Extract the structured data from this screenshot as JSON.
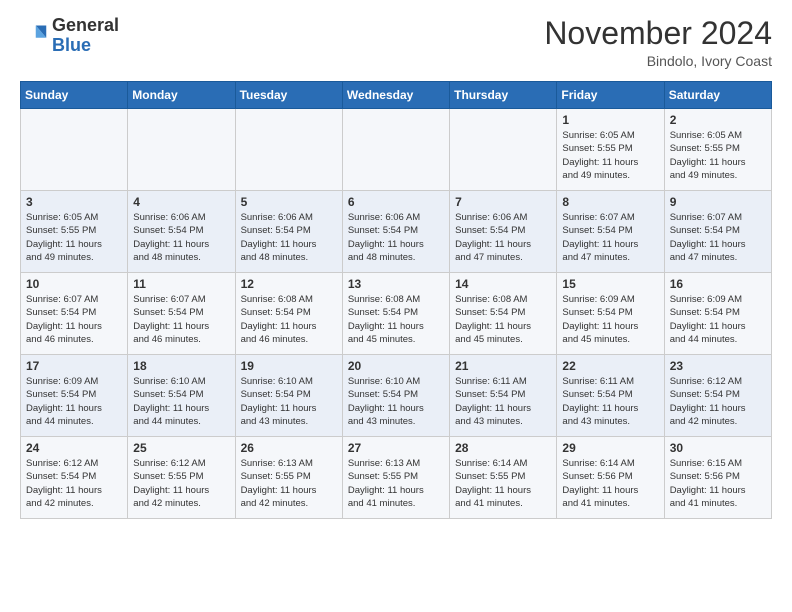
{
  "logo": {
    "general": "General",
    "blue": "Blue"
  },
  "header": {
    "month": "November 2024",
    "location": "Bindolo, Ivory Coast"
  },
  "weekdays": [
    "Sunday",
    "Monday",
    "Tuesday",
    "Wednesday",
    "Thursday",
    "Friday",
    "Saturday"
  ],
  "weeks": [
    [
      {
        "day": "",
        "info": ""
      },
      {
        "day": "",
        "info": ""
      },
      {
        "day": "",
        "info": ""
      },
      {
        "day": "",
        "info": ""
      },
      {
        "day": "",
        "info": ""
      },
      {
        "day": "1",
        "info": "Sunrise: 6:05 AM\nSunset: 5:55 PM\nDaylight: 11 hours\nand 49 minutes."
      },
      {
        "day": "2",
        "info": "Sunrise: 6:05 AM\nSunset: 5:55 PM\nDaylight: 11 hours\nand 49 minutes."
      }
    ],
    [
      {
        "day": "3",
        "info": "Sunrise: 6:05 AM\nSunset: 5:55 PM\nDaylight: 11 hours\nand 49 minutes."
      },
      {
        "day": "4",
        "info": "Sunrise: 6:06 AM\nSunset: 5:54 PM\nDaylight: 11 hours\nand 48 minutes."
      },
      {
        "day": "5",
        "info": "Sunrise: 6:06 AM\nSunset: 5:54 PM\nDaylight: 11 hours\nand 48 minutes."
      },
      {
        "day": "6",
        "info": "Sunrise: 6:06 AM\nSunset: 5:54 PM\nDaylight: 11 hours\nand 48 minutes."
      },
      {
        "day": "7",
        "info": "Sunrise: 6:06 AM\nSunset: 5:54 PM\nDaylight: 11 hours\nand 47 minutes."
      },
      {
        "day": "8",
        "info": "Sunrise: 6:07 AM\nSunset: 5:54 PM\nDaylight: 11 hours\nand 47 minutes."
      },
      {
        "day": "9",
        "info": "Sunrise: 6:07 AM\nSunset: 5:54 PM\nDaylight: 11 hours\nand 47 minutes."
      }
    ],
    [
      {
        "day": "10",
        "info": "Sunrise: 6:07 AM\nSunset: 5:54 PM\nDaylight: 11 hours\nand 46 minutes."
      },
      {
        "day": "11",
        "info": "Sunrise: 6:07 AM\nSunset: 5:54 PM\nDaylight: 11 hours\nand 46 minutes."
      },
      {
        "day": "12",
        "info": "Sunrise: 6:08 AM\nSunset: 5:54 PM\nDaylight: 11 hours\nand 46 minutes."
      },
      {
        "day": "13",
        "info": "Sunrise: 6:08 AM\nSunset: 5:54 PM\nDaylight: 11 hours\nand 45 minutes."
      },
      {
        "day": "14",
        "info": "Sunrise: 6:08 AM\nSunset: 5:54 PM\nDaylight: 11 hours\nand 45 minutes."
      },
      {
        "day": "15",
        "info": "Sunrise: 6:09 AM\nSunset: 5:54 PM\nDaylight: 11 hours\nand 45 minutes."
      },
      {
        "day": "16",
        "info": "Sunrise: 6:09 AM\nSunset: 5:54 PM\nDaylight: 11 hours\nand 44 minutes."
      }
    ],
    [
      {
        "day": "17",
        "info": "Sunrise: 6:09 AM\nSunset: 5:54 PM\nDaylight: 11 hours\nand 44 minutes."
      },
      {
        "day": "18",
        "info": "Sunrise: 6:10 AM\nSunset: 5:54 PM\nDaylight: 11 hours\nand 44 minutes."
      },
      {
        "day": "19",
        "info": "Sunrise: 6:10 AM\nSunset: 5:54 PM\nDaylight: 11 hours\nand 43 minutes."
      },
      {
        "day": "20",
        "info": "Sunrise: 6:10 AM\nSunset: 5:54 PM\nDaylight: 11 hours\nand 43 minutes."
      },
      {
        "day": "21",
        "info": "Sunrise: 6:11 AM\nSunset: 5:54 PM\nDaylight: 11 hours\nand 43 minutes."
      },
      {
        "day": "22",
        "info": "Sunrise: 6:11 AM\nSunset: 5:54 PM\nDaylight: 11 hours\nand 43 minutes."
      },
      {
        "day": "23",
        "info": "Sunrise: 6:12 AM\nSunset: 5:54 PM\nDaylight: 11 hours\nand 42 minutes."
      }
    ],
    [
      {
        "day": "24",
        "info": "Sunrise: 6:12 AM\nSunset: 5:54 PM\nDaylight: 11 hours\nand 42 minutes."
      },
      {
        "day": "25",
        "info": "Sunrise: 6:12 AM\nSunset: 5:55 PM\nDaylight: 11 hours\nand 42 minutes."
      },
      {
        "day": "26",
        "info": "Sunrise: 6:13 AM\nSunset: 5:55 PM\nDaylight: 11 hours\nand 42 minutes."
      },
      {
        "day": "27",
        "info": "Sunrise: 6:13 AM\nSunset: 5:55 PM\nDaylight: 11 hours\nand 41 minutes."
      },
      {
        "day": "28",
        "info": "Sunrise: 6:14 AM\nSunset: 5:55 PM\nDaylight: 11 hours\nand 41 minutes."
      },
      {
        "day": "29",
        "info": "Sunrise: 6:14 AM\nSunset: 5:56 PM\nDaylight: 11 hours\nand 41 minutes."
      },
      {
        "day": "30",
        "info": "Sunrise: 6:15 AM\nSunset: 5:56 PM\nDaylight: 11 hours\nand 41 minutes."
      }
    ]
  ]
}
